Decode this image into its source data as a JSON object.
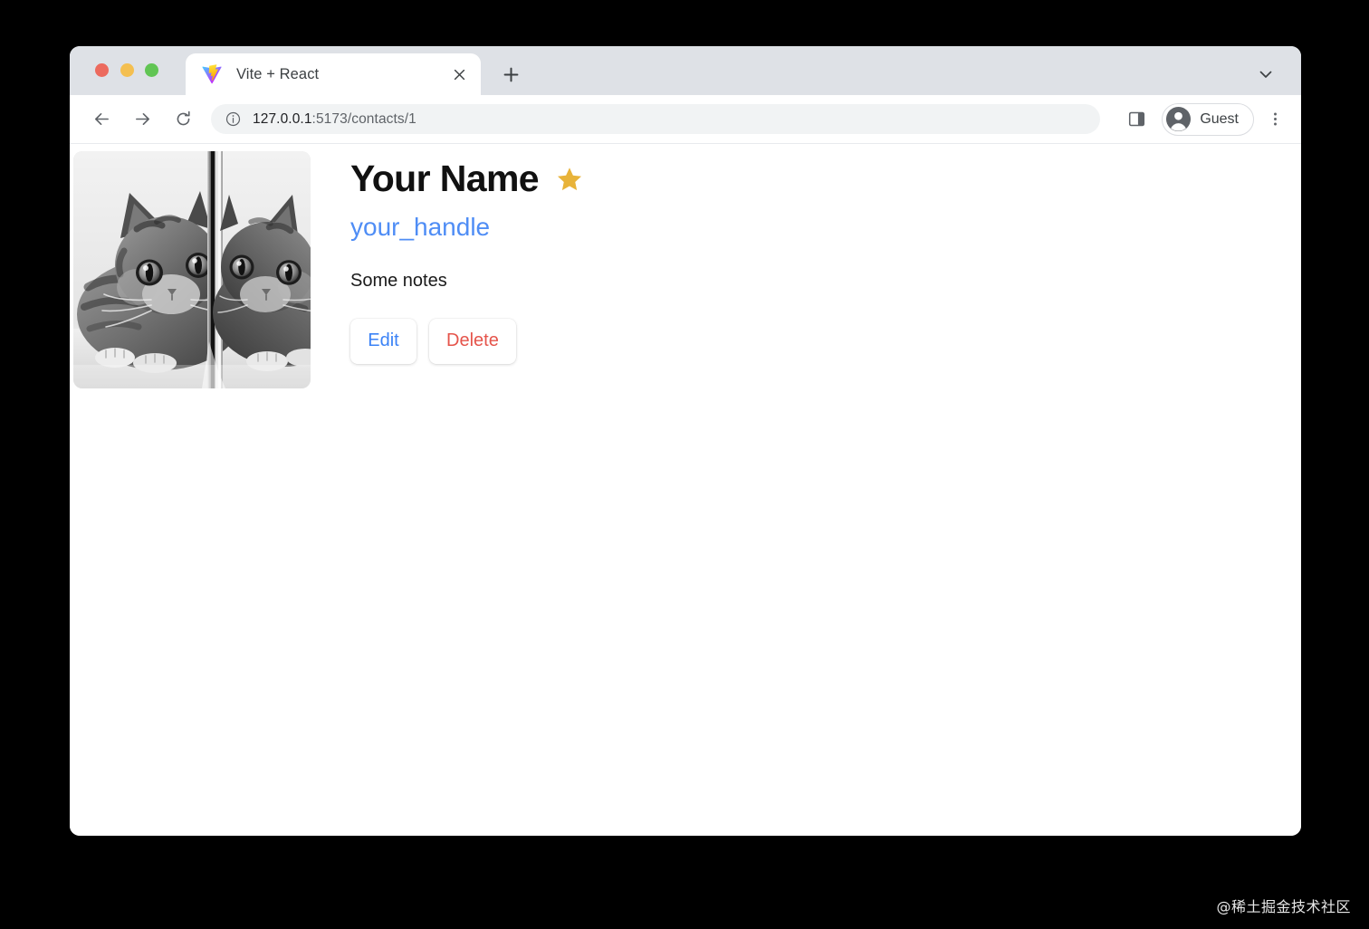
{
  "window": {
    "traffic_lights": [
      {
        "name": "close",
        "color": "#ec6a5e"
      },
      {
        "name": "minimize",
        "color": "#f4bf50"
      },
      {
        "name": "maximize",
        "color": "#61c554"
      }
    ]
  },
  "tab_strip": {
    "tabs": [
      {
        "title": "Vite + React",
        "favicon": "vite-logo-icon",
        "close_label": "close-tab-icon"
      }
    ],
    "new_tab_label": "+",
    "chevron_label": "chevron-down-icon"
  },
  "toolbar": {
    "back_label": "arrow-left-icon",
    "forward_label": "arrow-right-icon",
    "reload_label": "reload-icon",
    "omnibox": {
      "security_icon": "info-circle-icon",
      "host": "127.0.0.1",
      "path": ":5173/contacts/1",
      "full_url": "127.0.0.1:5173/contacts/1"
    },
    "side_panel_label": "side-panel-icon",
    "profile": {
      "name": "Guest",
      "avatar_icon": "account-circle-icon"
    },
    "menu_label": "three-dots-menu-icon"
  },
  "page": {
    "avatar": {
      "alt": "kitten-photo-with-mirror-reflection",
      "grayscale": true
    },
    "contact": {
      "name": "Your Name",
      "favorite": true,
      "favorite_icon": "star-icon",
      "favorite_color": "#e8b339",
      "handle": "your_handle",
      "handle_color": "#4f8df5",
      "notes": "Some notes"
    },
    "actions": [
      {
        "label": "Edit",
        "name": "edit-button",
        "color": "#3b82f6"
      },
      {
        "label": "Delete",
        "name": "delete-button",
        "color": "#e5544b"
      }
    ]
  },
  "watermark": {
    "text": "@稀土掘金技术社区"
  }
}
